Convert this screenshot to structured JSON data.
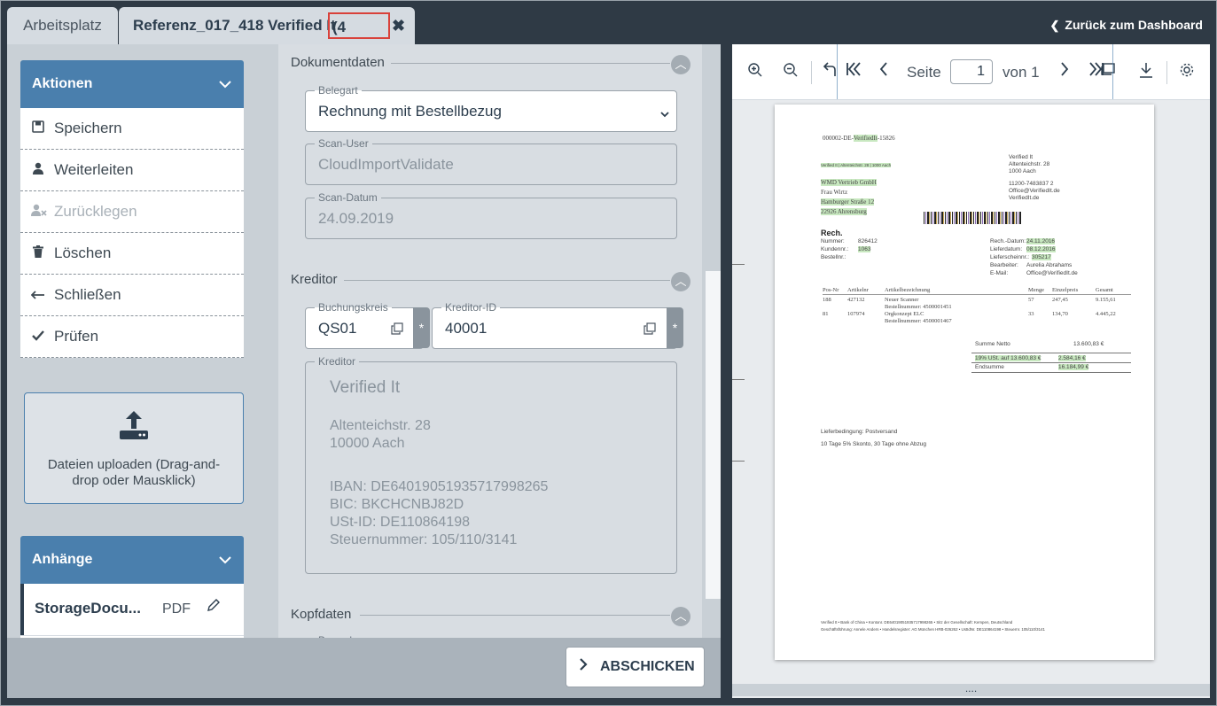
{
  "tabs": {
    "tab1": "Arbeitsplatz",
    "tab2": "Referenz_017_418 Verified It",
    "more": "(4 more)"
  },
  "back_link": "Zurück zum Dashboard",
  "actions": {
    "title": "Aktionen",
    "items": [
      {
        "label": "Speichern",
        "icon": "save-icon",
        "disabled": false
      },
      {
        "label": "Weiterleiten",
        "icon": "user-icon",
        "disabled": false
      },
      {
        "label": "Zurücklegen",
        "icon": "user-remove-icon",
        "disabled": true
      },
      {
        "label": "Löschen",
        "icon": "trash-icon",
        "disabled": false
      },
      {
        "label": "Schließen",
        "icon": "arrow-left-icon",
        "disabled": false
      },
      {
        "label": "Prüfen",
        "icon": "check-icon",
        "disabled": false
      }
    ]
  },
  "upload": {
    "text": "Dateien uploaden (Drag-and-drop oder Mausklick)"
  },
  "attachments": {
    "title": "Anhänge",
    "items": [
      {
        "name": "StorageDocu...",
        "type": "PDF"
      }
    ]
  },
  "sections": {
    "dokumentdaten": "Dokumentdaten",
    "kreditor": "Kreditor",
    "kopfdaten": "Kopfdaten"
  },
  "fields": {
    "belegart": {
      "label": "Belegart",
      "value": "Rechnung mit Bestellbezug"
    },
    "scan_user": {
      "label": "Scan-User",
      "value": "CloudImportValidate"
    },
    "scan_datum": {
      "label": "Scan-Datum",
      "value": "24.09.2019"
    },
    "buchungskreis": {
      "label": "Buchungskreis",
      "value": "QS01"
    },
    "kreditor_id": {
      "label": "Kreditor-ID",
      "value": "40001"
    },
    "kreditor": {
      "label": "Kreditor",
      "name": "Verified It",
      "street": "Altenteichstr. 28",
      "city": "10000 Aach",
      "iban": "IBAN:  DE64019051935717998265",
      "bic": "BIC:  BKCHCNBJ82D",
      "ust": "USt-ID:  DE110864198",
      "steuer": "Steuernummer:  105/110/3141"
    },
    "barcode": {
      "label": "Barcode"
    }
  },
  "required_mark": "*",
  "submit": "ABSCHICKEN",
  "viewer": {
    "seite": "Seite",
    "page": "1",
    "von": "von 1",
    "footer_dots": "...."
  },
  "document": {
    "ref_prefix": "000002-DE-",
    "ref_hl": "VerifiedIt",
    "ref_suffix": "-15826",
    "sender_line": "Verified It | Altenteichstr. 28 | 1000 Aach",
    "sender_block": [
      "Verified It",
      "Altenteichstr. 28",
      "1000 Aach"
    ],
    "contact": [
      "11200-7483837 2",
      "Office@VerifiedIt.de",
      "VerifiedIt.de"
    ],
    "recipient": [
      "WMD Vertrieb GmbH",
      "Frau Wirtz",
      "Hamburger Straße 12",
      "22926 Ahrensburg"
    ],
    "rech_title": "Rech.",
    "left_meta": [
      [
        "Nummer:",
        "826412"
      ],
      [
        "Kundennr.:",
        "1063"
      ],
      [
        "Bestellnr.:",
        ""
      ]
    ],
    "right_meta": [
      [
        "Rech.-Datum:",
        "24.11.2016"
      ],
      [
        "Lieferdatum:",
        "08.12.2016"
      ],
      [
        "Lieferscheinnr.:",
        "305217"
      ],
      [
        "Bearbeiter:",
        "Aurelia Abrahams"
      ],
      [
        "E-Mail:",
        "Office@VerifiedIt.de"
      ]
    ],
    "table_head": [
      "Pos-Nr",
      "Artikelnr",
      "Artikelbezeichnung",
      "Menge",
      "Einzelpreis",
      "Gesamt"
    ],
    "rows": [
      [
        "188",
        "427132",
        "Neuer Scanner",
        "57",
        "247,45",
        "9.155,61"
      ],
      [
        "",
        "",
        "Bestellnummer: 4500001451",
        "",
        "",
        ""
      ],
      [
        "81",
        "107974",
        "Orgkonzept ELC",
        "33",
        "134,70",
        "4.445,22"
      ],
      [
        "",
        "",
        "Bestellnummer: 4500001467",
        "",
        "",
        ""
      ]
    ],
    "summe_label": "Summe Netto",
    "summe_value": "13.600,83 €",
    "ust_label": "19% USt. auf 13.600,83 €",
    "ust_value": "2.584,16 €",
    "end_label": "Endsumme",
    "end_value": "16.184,99 €",
    "liefer": "Lieferbedingung: Postversand",
    "zahlung": "10 Tage 5% Skonto, 30 Tage ohne Abzug",
    "foot1": "Verified It • Bank of China • Kontonr. DE64019051935717998265 • Sitz der Gesellschaft: Kempen, Deutschland",
    "foot2": "Geschäftsführung: Annele Anders • Handelsregister: AG München HRB-026262 • UstIdNr. DE110864198 • Steuernr. 105/110/3141"
  }
}
